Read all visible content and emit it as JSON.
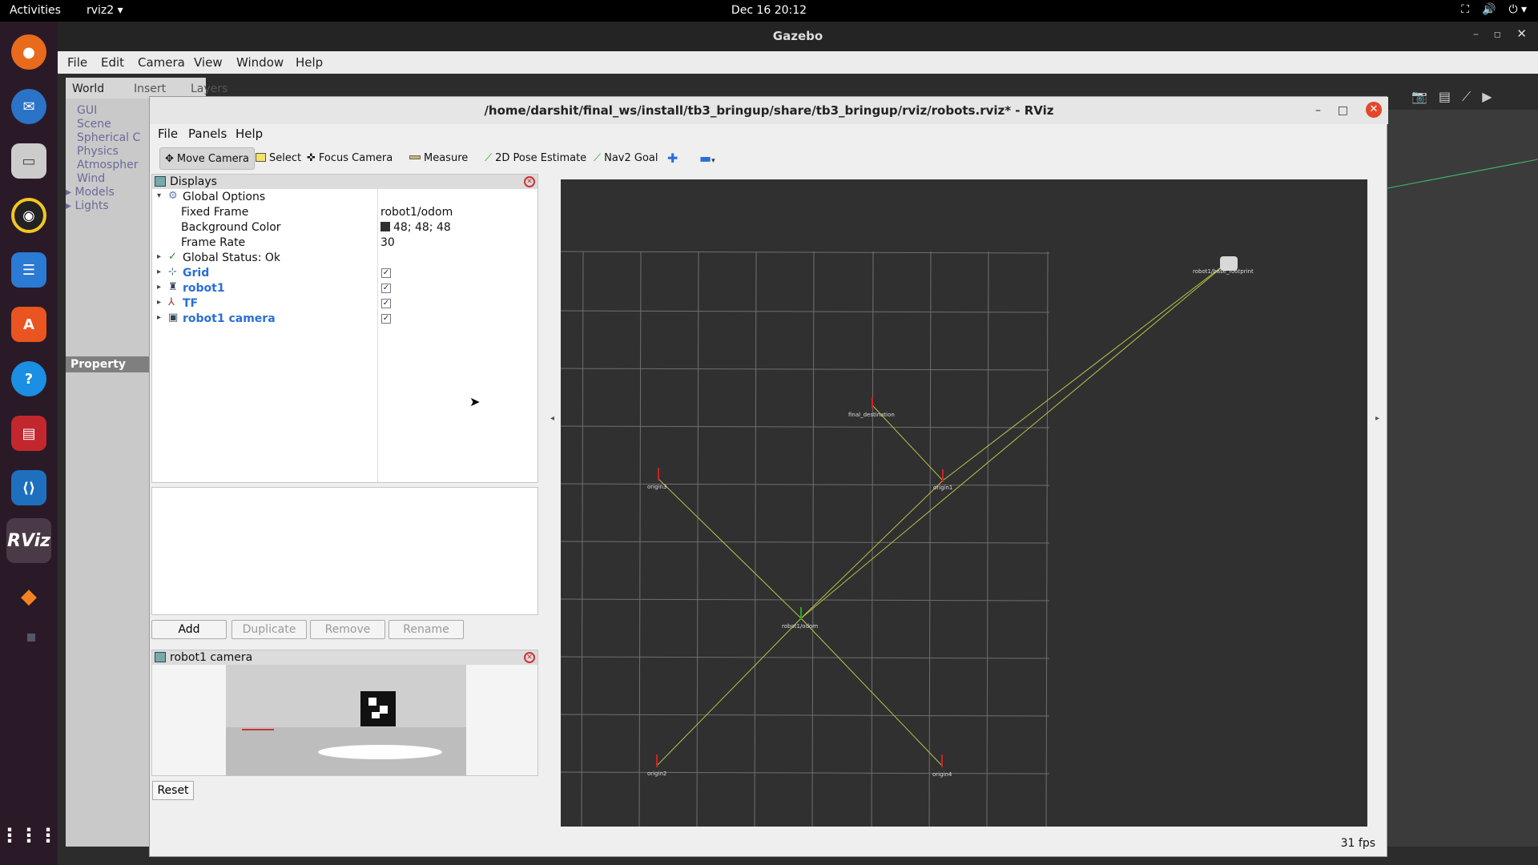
{
  "topbar": {
    "activities": "Activities",
    "app": "rviz2",
    "clock": "Dec 16  20:12"
  },
  "dock": {
    "items": [
      "firefox-icon",
      "thunderbird-icon",
      "files-icon",
      "rhythmbox-icon",
      "writer-icon",
      "app-center-icon",
      "help-icon",
      "terminal-icon",
      "vscode-icon",
      "rviz-icon",
      "gazebo-icon",
      "show-apps-icon"
    ],
    "rviz_label": "RViz"
  },
  "gazebo": {
    "title": "Gazebo",
    "menu": [
      "File",
      "Edit",
      "Camera",
      "View",
      "Window",
      "Help"
    ],
    "tabs": [
      "World",
      "Insert",
      "Layers"
    ],
    "tree": [
      "GUI",
      "Scene",
      "Spherical C",
      "Physics",
      "Atmospher",
      "Wind",
      "Models",
      "Lights"
    ],
    "property_label": "Property"
  },
  "rviz": {
    "title": "/home/darshit/final_ws/install/tb3_bringup/share/tb3_bringup/rviz/robots.rviz* - RViz",
    "menu": [
      "File",
      "Panels",
      "Help"
    ],
    "tools": {
      "move_camera": "Move Camera",
      "select": "Select",
      "focus_camera": "Focus Camera",
      "measure": "Measure",
      "pose_estimate": "2D Pose Estimate",
      "nav2_goal": "Nav2 Goal"
    },
    "displays": {
      "title": "Displays",
      "global_options": "Global Options",
      "fixed_frame_label": "Fixed Frame",
      "fixed_frame_value": "robot1/odom",
      "bg_label": "Background Color",
      "bg_value": "48; 48; 48",
      "frame_rate_label": "Frame Rate",
      "frame_rate_value": "30",
      "global_status": "Global Status: Ok",
      "grid": "Grid",
      "robot1": "robot1",
      "tf": "TF",
      "robot1_camera": "robot1 camera"
    },
    "buttons": {
      "add": "Add",
      "duplicate": "Duplicate",
      "remove": "Remove",
      "rename": "Rename"
    },
    "camera_panel_title": "robot1 camera",
    "reset": "Reset",
    "fps": "31 fps",
    "frame_labels": {
      "robot1_base": "robot1/base_footprint",
      "final_destination": "final_destination",
      "origin1": "origin1",
      "origin2": "origin2",
      "origin3": "origin3",
      "origin4": "origin4",
      "robot1_odom": "robot1/odom"
    }
  },
  "colors": {
    "viewport_bg": "#303030",
    "tf_line": "#b8c24a",
    "grid_line": "#a0a0a0",
    "dock_bg": "#2a1a27"
  }
}
